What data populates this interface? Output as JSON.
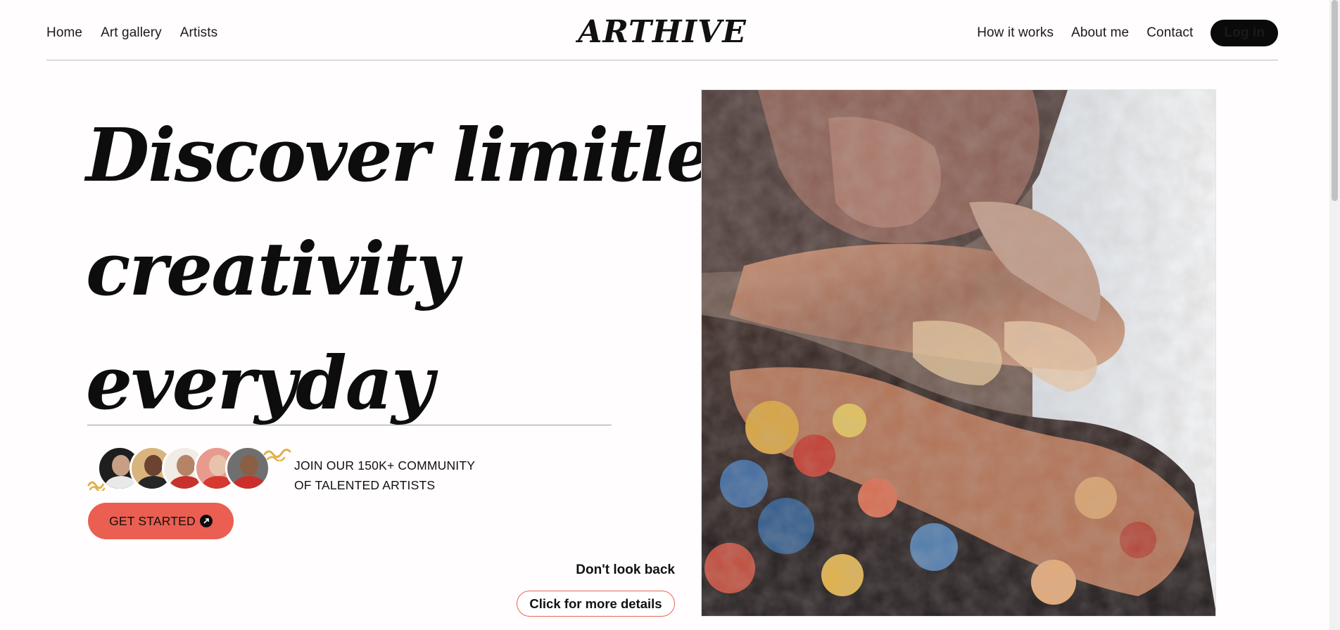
{
  "nav": {
    "left_links": [
      "Home",
      "Art gallery",
      "Artists"
    ],
    "logo": "ARTHIVE",
    "right_links": [
      "How it works",
      "About me",
      "Contact"
    ],
    "login_label": "Log in"
  },
  "hero": {
    "headline_lines": [
      "Discover limitless",
      "creativity",
      "everyday"
    ],
    "community_line1": "JOIN OUR 150K+ COMMUNITY",
    "community_line2": "OF TALENTED ARTISTS",
    "cta_label": "GET STARTED",
    "artwork_caption": "Don't look back",
    "details_label": "Click for more details"
  },
  "colors": {
    "accent": "#ea5f52",
    "squiggle": "#e0b04a",
    "text": "#111111",
    "background": "#fffdfd"
  },
  "icons": [
    "arrow-up-right-icon",
    "squiggle-decoration",
    "avatar-photo"
  ]
}
